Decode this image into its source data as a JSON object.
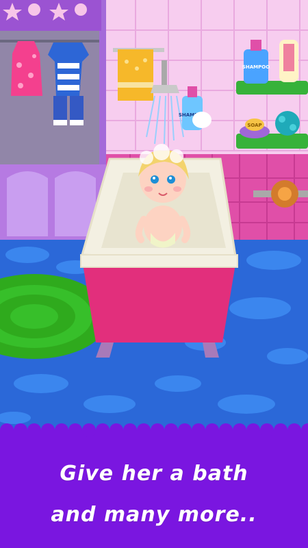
{
  "caption": {
    "line1": "Give her a bath",
    "line2": "and many more.."
  },
  "labels": {
    "shampoo_bottle_1": "SHAMPOO",
    "shampoo_bottle_2": "SHAMPOO",
    "soap": "SOAP"
  },
  "colors": {
    "wall": "#f5c6ef",
    "floor": "#2b68d8",
    "bathtub": "#e22f7c",
    "panel": "#7a16e0",
    "rug": "#2faa1d",
    "shelf": "#37b23a"
  }
}
